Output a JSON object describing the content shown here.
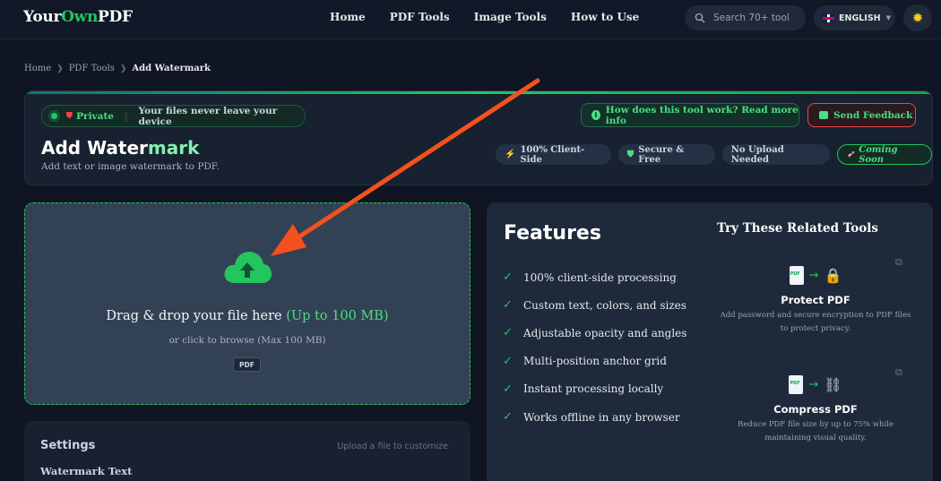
{
  "brand": {
    "part1": "Your",
    "part2": "Own",
    "part3": "PDF"
  },
  "nav": {
    "links": [
      "Home",
      "PDF Tools",
      "Image Tools",
      "How to Use"
    ]
  },
  "search": {
    "placeholder": "Search 70+ tool"
  },
  "language": {
    "selected": "ENGLISH"
  },
  "theme_icon": "sun-icon",
  "breadcrumb": {
    "items": [
      "Home",
      "PDF Tools"
    ],
    "current": "Add Watermark"
  },
  "header": {
    "private_label": "Private",
    "privacy_note": "Your files never leave your device",
    "info_button": "How does this tool work? Read more info",
    "feedback_button": "Send Feedback",
    "title_main": "Add Water",
    "title_accent": "mark",
    "subtitle": "Add text or image watermark to PDF.",
    "badges": [
      "100% Client-Side",
      "Secure & Free",
      "No Upload Needed",
      "Coming Soon"
    ]
  },
  "dropzone": {
    "title": "Drag & drop your file here",
    "limit": "(Up to 100 MB)",
    "subtitle": "or click to browse (Max 100 MB)",
    "file_type": "PDF"
  },
  "settings": {
    "heading": "Settings",
    "hint": "Upload a file to customize",
    "watermark_label": "Watermark Text"
  },
  "features": {
    "title": "Features",
    "items": [
      "100% client-side processing",
      "Custom text, colors, and sizes",
      "Adjustable opacity and angles",
      "Multi-position anchor grid",
      "Instant processing locally",
      "Works offline in any browser"
    ]
  },
  "related": {
    "title": "Try These Related Tools",
    "tools": [
      {
        "name": "Protect PDF",
        "desc1": "Add password and secure encryption to PDF files",
        "desc2": "to protect privacy."
      },
      {
        "name": "Compress PDF",
        "desc1": "Reduce PDF file size by up to 75% while",
        "desc2": "maintaining visual quality."
      }
    ]
  },
  "colors": {
    "accent": "#22c55e",
    "annotation": "#f4511e",
    "background": "#0f1522"
  }
}
